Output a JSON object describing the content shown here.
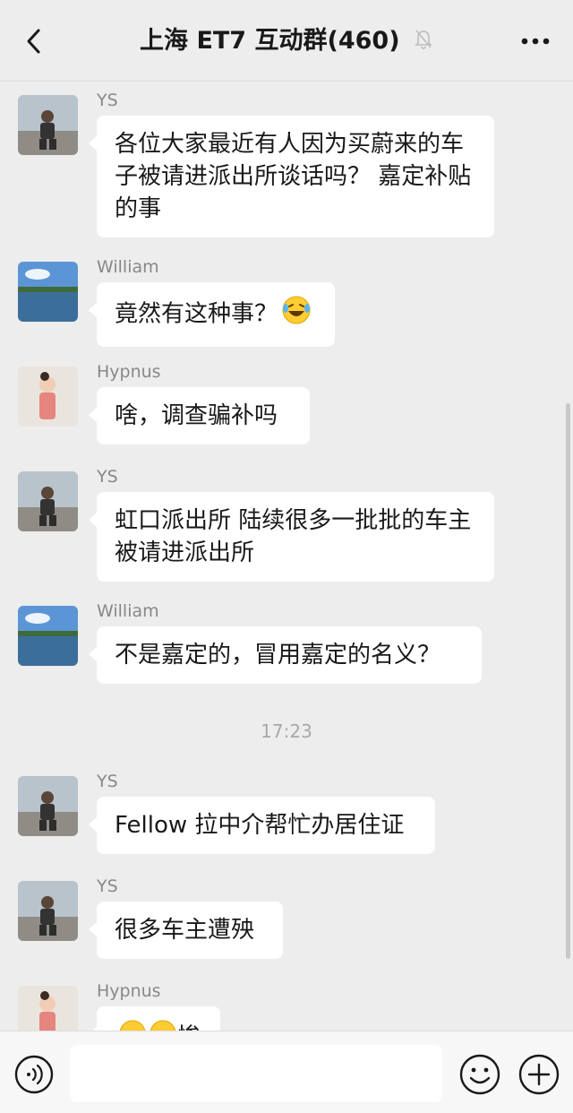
{
  "header": {
    "title": "上海 ET7 互动群(460)",
    "back_icon": "chevron-left-icon",
    "mute_icon": "bell-off-icon",
    "more_icon": "more-dots-icon"
  },
  "messages": [
    {
      "sender": "YS",
      "text": "各位大家最近有人因为买蔚来的车子被请进派出所谈话吗？ 嘉定补贴的事",
      "avatar": "man-on-road-avatar"
    },
    {
      "sender": "William",
      "text": "竟然有这种事？",
      "emoji": "laughing-tears-emoji",
      "avatar": "lake-landscape-avatar"
    },
    {
      "sender": "Hypnus",
      "text": "啥，调查骗补吗",
      "avatar": "child-photo-avatar"
    },
    {
      "sender": "YS",
      "text": "虹口派出所 陆续很多一批批的车主被请进派出所",
      "avatar": "man-on-road-avatar"
    },
    {
      "sender": "William",
      "text": "不是嘉定的，冒用嘉定的名义？",
      "avatar": "lake-landscape-avatar"
    },
    {
      "sender": "YS",
      "text": "Fellow 拉中介帮忙办居住证",
      "avatar": "man-on-road-avatar"
    },
    {
      "sender": "YS",
      "text": "很多车主遭殃",
      "avatar": "man-on-road-avatar"
    },
    {
      "sender": "Hypnus",
      "text": "惨",
      "emoji": "grimacing-emoji",
      "avatar": "child-photo-avatar"
    }
  ],
  "timestamp": "17:23",
  "input_bar": {
    "voice_icon": "voice-icon",
    "emoji_icon": "smiley-icon",
    "plus_icon": "plus-icon",
    "text_value": ""
  },
  "colors": {
    "background": "#ededed",
    "bubble": "#ffffff",
    "sender_name": "#888888"
  }
}
